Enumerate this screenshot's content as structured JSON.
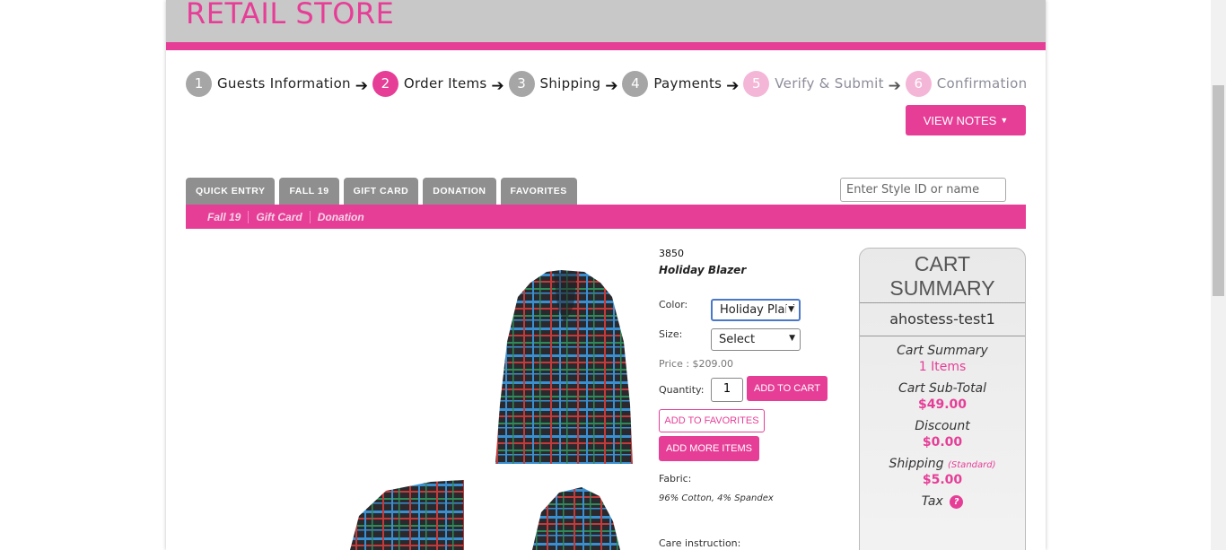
{
  "header": {
    "store_title": "RETAIL STORE"
  },
  "steps": [
    {
      "num": "1",
      "label": "Guests Information"
    },
    {
      "num": "2",
      "label": "Order Items"
    },
    {
      "num": "3",
      "label": "Shipping"
    },
    {
      "num": "4",
      "label": "Payments"
    },
    {
      "num": "5",
      "label": "Verify & Submit"
    },
    {
      "num": "6",
      "label": "Confirmation"
    }
  ],
  "view_notes": {
    "label": "VIEW NOTES"
  },
  "tabs": [
    "QUICK ENTRY",
    "FALL 19",
    "GIFT CARD",
    "DONATION",
    "FAVORITES"
  ],
  "search": {
    "placeholder": "Enter Style ID or name"
  },
  "subnav": [
    "Fall 19",
    "Gift Card",
    "Donation"
  ],
  "product": {
    "sku": "3850",
    "name": "Holiday Blazer",
    "color_label": "Color:",
    "color_value": "Holiday Plaid",
    "size_label": "Size:",
    "size_value": "Select",
    "price": "Price : $209.00",
    "quantity_label": "Quantity:",
    "quantity_value": "1",
    "add_to_cart": "ADD TO CART",
    "add_to_favorites": "ADD TO FAVORITES",
    "add_more_items": "ADD MORE ITEMS",
    "fabric_label": "Fabric:",
    "fabric_value": "96% Cotton, 4% Spandex",
    "care_label": "Care instruction:"
  },
  "cart": {
    "title": "CART SUMMARY",
    "user": "ahostess-test1",
    "summary_label": "Cart Summary",
    "items": "1 Items",
    "subtotal_label": "Cart Sub-Total",
    "subtotal": "$49.00",
    "discount_label": "Discount",
    "discount": "$0.00",
    "shipping_label": "Shipping",
    "shipping_note": "(Standard)",
    "shipping": "$5.00",
    "tax_label": "Tax",
    "tax_help": "?"
  },
  "colors": {
    "accent": "#e63e97",
    "header_gray": "#c8c8c8",
    "tab_gray": "#8f8f8f"
  },
  "icons": [
    "arrow-right-icon",
    "chevron-down-icon",
    "help-icon"
  ]
}
